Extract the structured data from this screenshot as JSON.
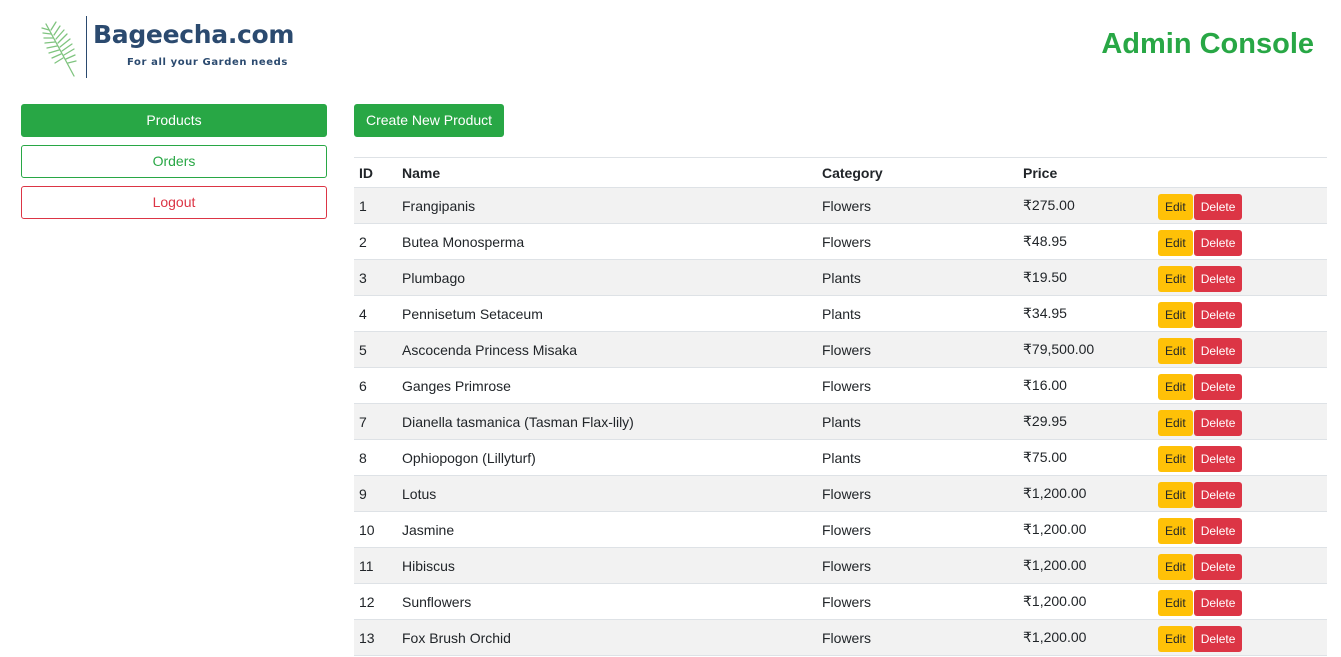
{
  "header": {
    "logo_name": "Bageecha.com",
    "logo_tagline": "For all your Garden needs",
    "console_title": "Admin Console"
  },
  "sidebar": {
    "items": [
      {
        "label": "Products"
      },
      {
        "label": "Orders"
      },
      {
        "label": "Logout"
      }
    ]
  },
  "main": {
    "create_label": "Create New Product",
    "table": {
      "headers": [
        "ID",
        "Name",
        "Category",
        "Price"
      ],
      "edit_label": "Edit",
      "delete_label": "Delete",
      "rows": [
        {
          "id": "1",
          "name": "Frangipanis",
          "category": "Flowers",
          "price": "₹275.00"
        },
        {
          "id": "2",
          "name": "Butea Monosperma",
          "category": "Flowers",
          "price": "₹48.95"
        },
        {
          "id": "3",
          "name": "Plumbago",
          "category": "Plants",
          "price": "₹19.50"
        },
        {
          "id": "4",
          "name": "Pennisetum Setaceum",
          "category": "Plants",
          "price": "₹34.95"
        },
        {
          "id": "5",
          "name": "Ascocenda Princess Misaka",
          "category": "Flowers",
          "price": "₹79,500.00"
        },
        {
          "id": "6",
          "name": "Ganges Primrose",
          "category": "Flowers",
          "price": "₹16.00"
        },
        {
          "id": "7",
          "name": "Dianella tasmanica (Tasman Flax-lily)",
          "category": "Plants",
          "price": "₹29.95"
        },
        {
          "id": "8",
          "name": "Ophiopogon (Lillyturf)",
          "category": "Plants",
          "price": "₹75.00"
        },
        {
          "id": "9",
          "name": "Lotus",
          "category": "Flowers",
          "price": "₹1,200.00"
        },
        {
          "id": "10",
          "name": "Jasmine",
          "category": "Flowers",
          "price": "₹1,200.00"
        },
        {
          "id": "11",
          "name": "Hibiscus",
          "category": "Flowers",
          "price": "₹1,200.00"
        },
        {
          "id": "12",
          "name": "Sunflowers",
          "category": "Flowers",
          "price": "₹1,200.00"
        },
        {
          "id": "13",
          "name": "Fox Brush Orchid",
          "category": "Flowers",
          "price": "₹1,200.00"
        }
      ]
    }
  },
  "colors": {
    "success": "#28a745",
    "danger": "#dc3545",
    "warning": "#ffc107",
    "brand_blue": "#2b4a6f"
  },
  "icons": {
    "logo": "palm-leaf-icon"
  }
}
